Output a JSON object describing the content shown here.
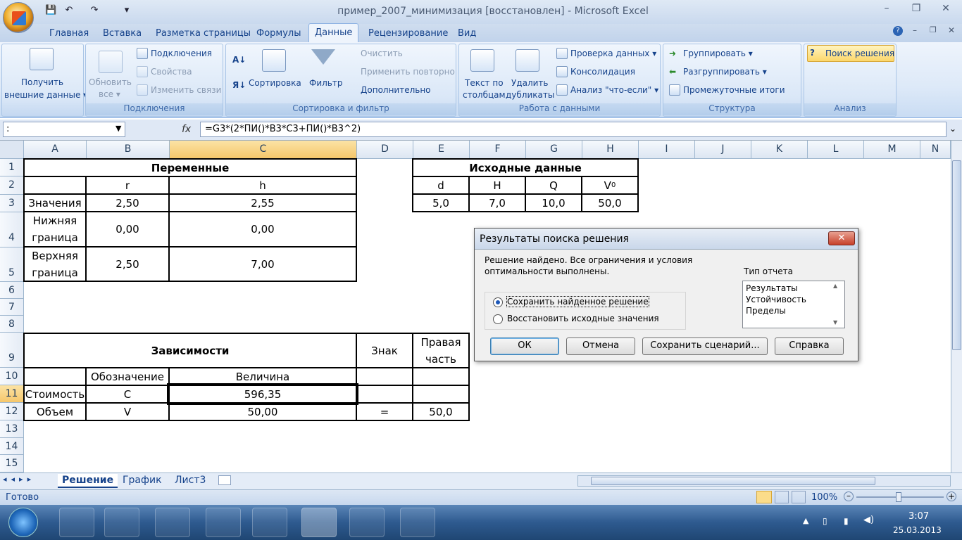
{
  "window": {
    "title": "пример_2007_минимизация [восстановлен] - Microsoft Excel",
    "minimize": "–",
    "restore": "❐",
    "close": "✕"
  },
  "ribbon_tabs": [
    "Главная",
    "Вставка",
    "Разметка страницы",
    "Формулы",
    "Данные",
    "Рецензирование",
    "Вид"
  ],
  "ribbon": {
    "get_external": [
      "Получить",
      "внешние данные ▾"
    ],
    "refresh": [
      "Обновить",
      "все ▾"
    ],
    "connections": "Подключения",
    "properties": "Свойства",
    "edit_links": "Изменить связи",
    "group_connections": "Подключения",
    "sort_az": "А↓",
    "sort_big": "Сортировка",
    "filter": "Фильтр",
    "clear": "Очистить",
    "reapply": "Применить повторно",
    "advanced": "Дополнительно",
    "group_sort": "Сортировка и фильтр",
    "text_to_cols": [
      "Текст по",
      "столбцам"
    ],
    "remove_dups": [
      "Удалить",
      "дубликаты"
    ],
    "data_validation": "Проверка данных ▾",
    "consolidate": "Консолидация",
    "what_if": "Анализ \"что-если\" ▾",
    "group_data_tools": "Работа с данными",
    "group_btn": "Группировать ▾",
    "ungroup_btn": "Разгруппировать ▾",
    "subtotal": "Промежуточные итоги",
    "group_structure": "Структура",
    "solver": "Поиск решения",
    "group_analysis": "Анализ"
  },
  "formula_bar": {
    "name_box": ":",
    "fx": "fx",
    "formula": "=G3*(2*ПИ()*B3*C3+ПИ()*B3^2)"
  },
  "columns": [
    "A",
    "B",
    "C",
    "D",
    "E",
    "F",
    "G",
    "H",
    "I",
    "J",
    "K",
    "L",
    "M",
    "N"
  ],
  "rows": [
    "1",
    "2",
    "3",
    "4",
    "5",
    "6",
    "7",
    "8",
    "9",
    "10",
    "11",
    "12",
    "13",
    "14",
    "15"
  ],
  "sheet": {
    "variables_title": "Переменные",
    "r": "r",
    "h": "h",
    "values_label": "Значения",
    "r_value": "2,50",
    "h_value": "2,55",
    "lower_label": [
      "Нижняя",
      "граница"
    ],
    "r_lower": "0,00",
    "h_lower": "0,00",
    "upper_label": [
      "Верхняя",
      "граница"
    ],
    "r_upper": "2,50",
    "h_upper": "7,00",
    "input_title": "Исходные данные",
    "d": "d",
    "H": "H",
    "Q": "Q",
    "V0": "V",
    "V0_sub": "0",
    "d_val": "5,0",
    "H_val": "7,0",
    "Q_val": "10,0",
    "V0_val": "50,0",
    "dependencies_title": "Зависимости",
    "sign_header": "Знак",
    "right_header": [
      "Правая",
      "часть"
    ],
    "designation_header": "Обозначение",
    "value_header": "Величина",
    "cost_label": "Стоимость",
    "cost_symbol": "C",
    "cost_value": "596,35",
    "volume_label": "Объем",
    "volume_symbol": "V",
    "volume_value": "50,00",
    "volume_sign": "=",
    "volume_right": "50,0"
  },
  "sheet_tabs": [
    "Решение",
    "График",
    "Лист3"
  ],
  "status": {
    "ready": "Готово",
    "zoom": "100%"
  },
  "dialog": {
    "title": "Результаты поиска решения",
    "message": [
      "Решение найдено. Все ограничения и условия",
      "оптимальности выполнены."
    ],
    "report_type_label": "Тип отчета",
    "reports": [
      "Результаты",
      "Устойчивость",
      "Пределы"
    ],
    "option_keep": "Сохранить найденное решение",
    "option_restore": "Восстановить исходные значения",
    "ok": "ОК",
    "cancel": "Отмена",
    "save_scenario": "Сохранить сценарий...",
    "help": "Справка"
  },
  "taskbar": {
    "time": "3:07",
    "date": "25.03.2013"
  }
}
